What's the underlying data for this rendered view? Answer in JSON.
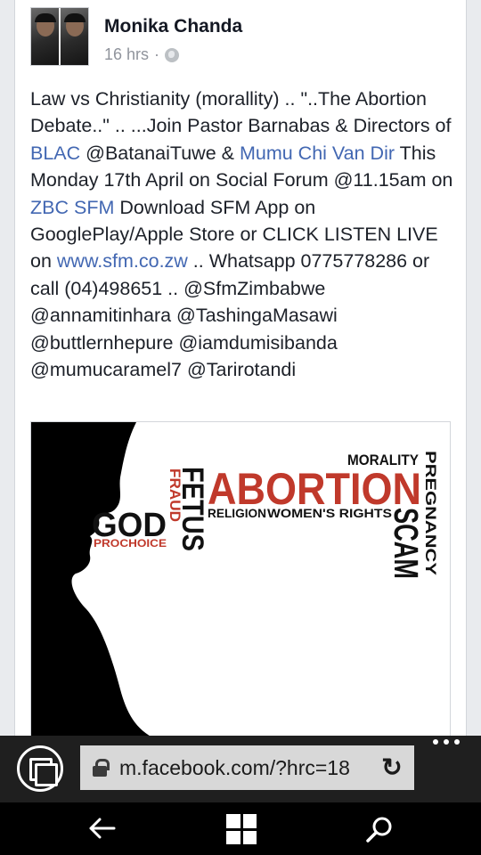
{
  "post": {
    "author": "Monika Chanda",
    "time": "16 hrs",
    "separator": "·",
    "privacy_icon": "globe-icon",
    "text_segments": [
      {
        "text": "Law vs Christianity (morallity) .. \"..The Abortion Debate..\" .. ...Join Pastor Barnabas & Directors of ",
        "link": false
      },
      {
        "text": "BLAC",
        "link": true
      },
      {
        "text": " @BatanaiTuwe & ",
        "link": false
      },
      {
        "text": "Mumu Chi Van Dir",
        "link": true
      },
      {
        "text": " This Monday 17th April on Social Forum @11.15am on ",
        "link": false
      },
      {
        "text": "ZBC SFM",
        "link": true
      },
      {
        "text": " Download SFM App on GooglePlay/Apple Store or CLICK LISTEN LIVE on ",
        "link": false
      },
      {
        "text": "www.sfm.co.zw",
        "link": true
      },
      {
        "text": " .. Whatsapp 0775778286 or call (04)498651 .. @SfmZimbabwe @annamitinhara @TashingaMasawi @buttlernhepure @iamdumisibanda @mumucaramel7 @Tarirotandi",
        "link": false
      }
    ],
    "image_words": {
      "abortion": "ABORTION",
      "morality": "MORALITY",
      "pregnancy": "PREGNANCY",
      "fetus": "FETUS",
      "fraud": "FRAUD",
      "god": "GOD",
      "prochoice": "PROCHOICE",
      "religion": "RELIGION",
      "womens_rights": "WOMEN'S RIGHTS",
      "scam": "SCAM"
    }
  },
  "browser": {
    "url": "m.facebook.com/?hrc=18",
    "tabs_icon": "tabs-icon",
    "lock_icon": "lock-icon",
    "refresh_icon": "refresh-icon",
    "more_icon": "more-icon"
  },
  "system_nav": {
    "back_icon": "back-arrow-icon",
    "start_icon": "windows-logo-icon",
    "search_icon": "search-icon"
  },
  "colors": {
    "link": "#4267b2",
    "word_black": "#111111",
    "word_red": "#c0392b",
    "browser_bg": "#1f1f1f",
    "nav_bg": "#000000"
  }
}
